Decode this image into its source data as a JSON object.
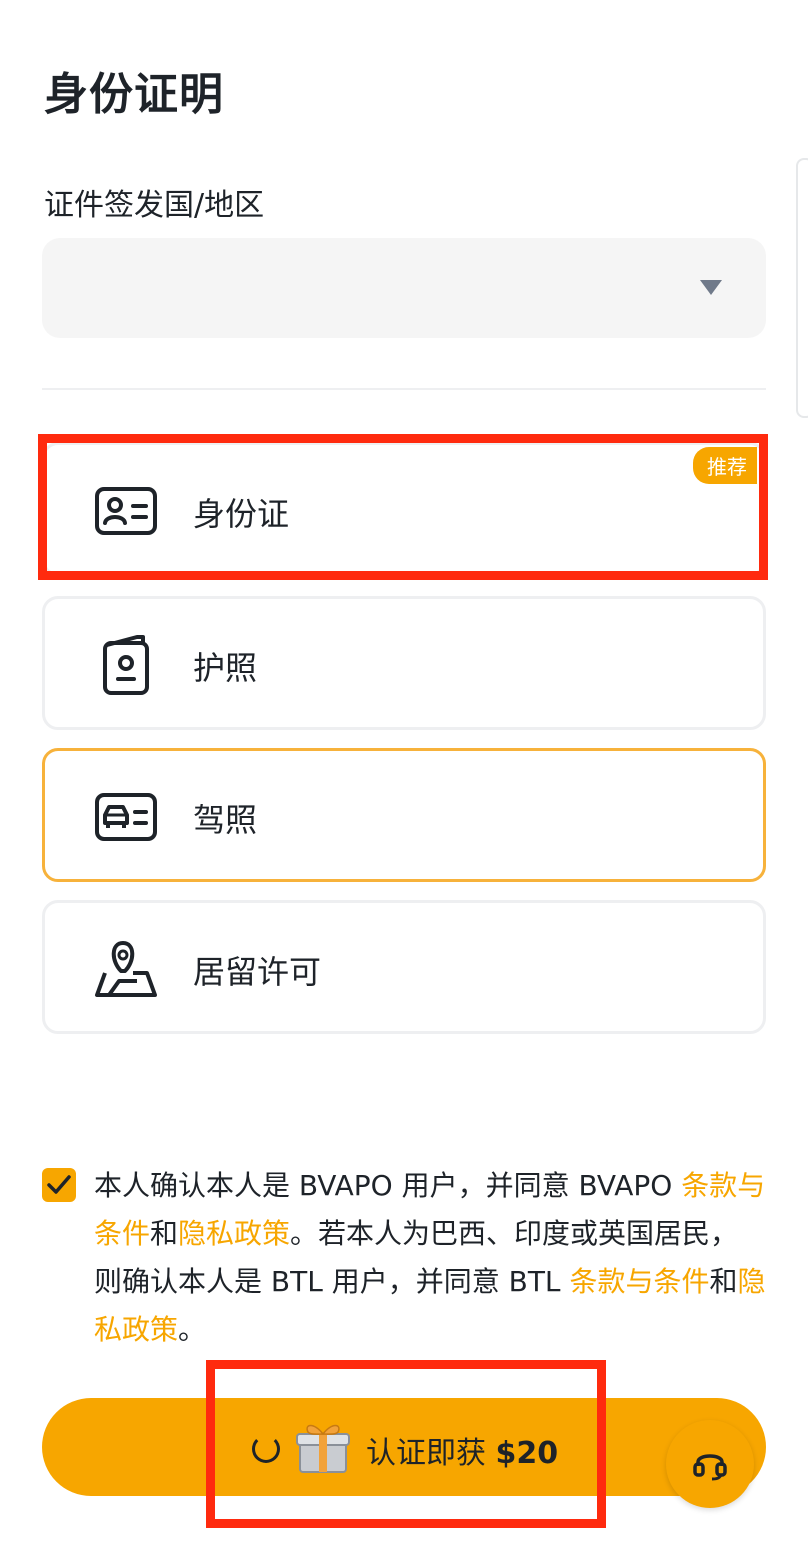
{
  "page": {
    "title": "身份证明"
  },
  "country": {
    "label": "证件签发国/地区",
    "value": ""
  },
  "doc_types": [
    {
      "label": "身份证",
      "icon": "id-card-icon",
      "badge": "推荐"
    },
    {
      "label": "护照",
      "icon": "passport-icon"
    },
    {
      "label": "驾照",
      "icon": "driver-license-icon"
    },
    {
      "label": "居留许可",
      "icon": "residence-permit-icon"
    }
  ],
  "consent": {
    "checked": true,
    "text_1": "本人确认本人是 BVAPO 用户，并同意 BVAPO ",
    "link_terms_1": "条款与条件",
    "and_1": "和",
    "link_privacy_1": "隐私政策",
    "text_2": "。若本人为巴西、印度或英国居民，则确认本人是 BTL 用户，并同意 BTL ",
    "link_terms_2": "条款与条件",
    "and_2": "和",
    "link_privacy_2": "隐私政策",
    "text_3": "。"
  },
  "cta": {
    "label": "认证即获 ",
    "amount": "$20"
  },
  "icons": {
    "spinner": "loading-spinner-icon",
    "gift": "gift-icon",
    "support": "headset-icon",
    "check": "check-icon",
    "caret": "caret-down-icon"
  },
  "colors": {
    "accent": "#f7a600",
    "selected_border": "#f7b23b",
    "annotation": "#ff2a0e",
    "text": "#1e2329"
  }
}
